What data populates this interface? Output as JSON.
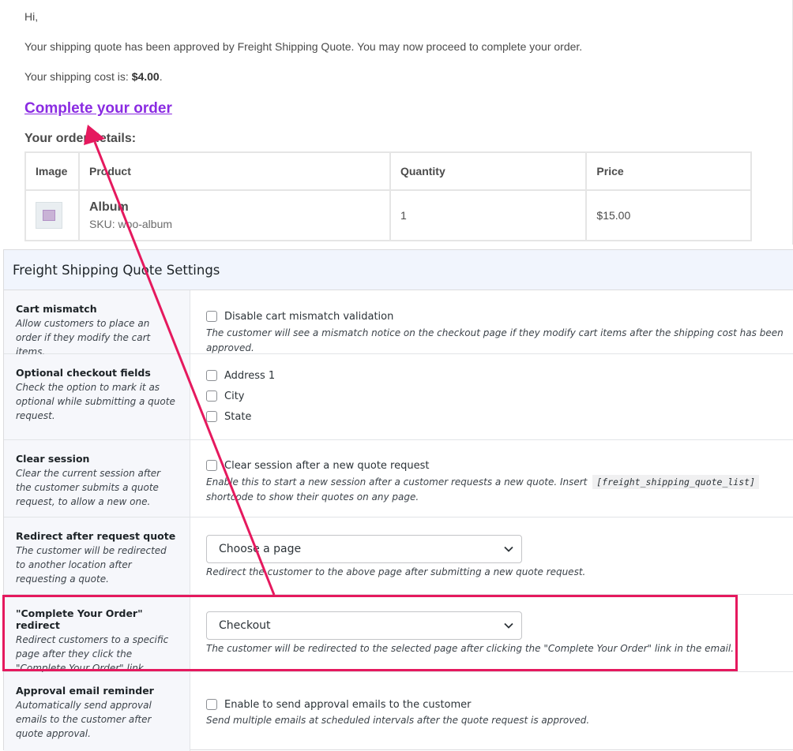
{
  "email": {
    "greeting": "Hi,",
    "approved_text": "Your shipping quote has been approved by Freight Shipping Quote. You may now proceed to complete your order.",
    "cost_prefix": "Your shipping cost is: ",
    "cost_value": "$4.00",
    "cost_suffix": ".",
    "complete_link": "Complete your order",
    "order_heading": "Your order details:",
    "table": {
      "headers": [
        "Image",
        "Product",
        "Quantity",
        "Price"
      ],
      "rows": [
        {
          "product": "Album",
          "sku": "SKU: woo-album",
          "quantity": "1",
          "price": "$15.00"
        }
      ]
    }
  },
  "settings": {
    "title": "Freight Shipping Quote Settings",
    "rows": [
      {
        "label": "Cart mismatch",
        "desc": "Allow customers to place an order if they modify the cart items.",
        "checkbox": "Disable cart mismatch validation",
        "help": "The customer will see a mismatch notice on the checkout page if they modify cart items after the shipping cost has been approved."
      },
      {
        "label": "Optional checkout fields",
        "desc": "Check the option to mark it as optional while submitting a quote request.",
        "options": [
          "Address 1",
          "City",
          "State"
        ]
      },
      {
        "label": "Clear session",
        "desc": "Clear the current session after the customer submits a quote request, to allow a new one.",
        "checkbox": "Clear session after a new quote request",
        "help_before": "Enable this to start a new session after a customer requests a new quote. Insert",
        "shortcode": "[freight_shipping_quote_list]",
        "help_after": "shortcode to show their quotes on any page."
      },
      {
        "label": "Redirect after request quote",
        "desc": "The customer will be redirected to another location after requesting a quote.",
        "select_value": "Choose a page",
        "help": "Redirect the customer to the above page after submitting a new quote request."
      },
      {
        "label": "\"Complete Your Order\" redirect",
        "desc": "Redirect customers to a specific page after they click the \"Complete Your Order\" link.",
        "select_value": "Checkout",
        "help": "The customer will be redirected to the selected page after clicking the \"Complete Your Order\" link in the email."
      },
      {
        "label": "Approval email reminder",
        "desc": "Automatically send approval emails to the customer after quote approval.",
        "checkbox": "Enable to send approval emails to the customer",
        "help": "Send multiple emails at scheduled intervals after the quote request is approved."
      }
    ]
  },
  "annotation": {
    "color": "#e5195e"
  },
  "colors": {
    "link": "#8a2be2",
    "settings_header_bg": "#f1f5fd"
  }
}
